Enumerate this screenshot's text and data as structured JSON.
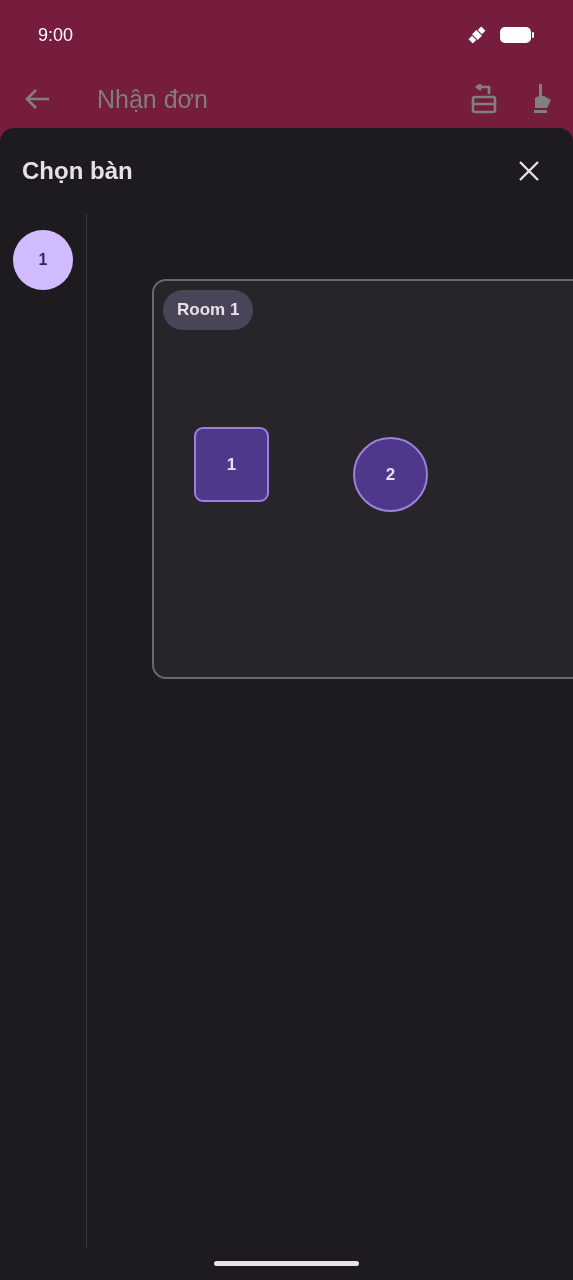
{
  "status_bar": {
    "time": "9:00"
  },
  "app_bar": {
    "title": "Nhận đơn"
  },
  "sheet": {
    "title": "Chọn bàn"
  },
  "rooms_rail": [
    {
      "label": "1",
      "selected": true
    }
  ],
  "room": {
    "label": "Room 1",
    "tables": [
      {
        "label": "1",
        "kind": "square"
      },
      {
        "label": "2",
        "kind": "round"
      }
    ]
  }
}
